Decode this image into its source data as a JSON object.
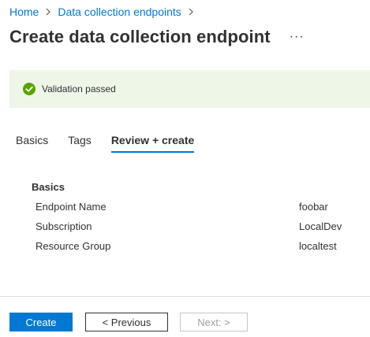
{
  "breadcrumb": {
    "items": [
      "Home",
      "Data collection endpoints"
    ]
  },
  "header": {
    "title": "Create data collection endpoint",
    "more_label": "···"
  },
  "validation": {
    "status": "success",
    "message": "Validation passed",
    "icon": "check-circle-icon",
    "color": "#57a300",
    "background": "#eef6e8"
  },
  "tabs": [
    {
      "label": "Basics",
      "active": false
    },
    {
      "label": "Tags",
      "active": false
    },
    {
      "label": "Review + create",
      "active": true
    }
  ],
  "review": {
    "section_title": "Basics",
    "rows": [
      {
        "label": "Endpoint Name",
        "value": "foobar"
      },
      {
        "label": "Subscription",
        "value": "LocalDev"
      },
      {
        "label": "Resource Group",
        "value": "localtest"
      }
    ]
  },
  "footer": {
    "create_label": "Create",
    "previous_label": "< Previous",
    "next_label": "Next: >",
    "next_disabled": true
  },
  "colors": {
    "accent": "#0078d4",
    "text": "#323130",
    "disabled": "#a19f9d"
  }
}
